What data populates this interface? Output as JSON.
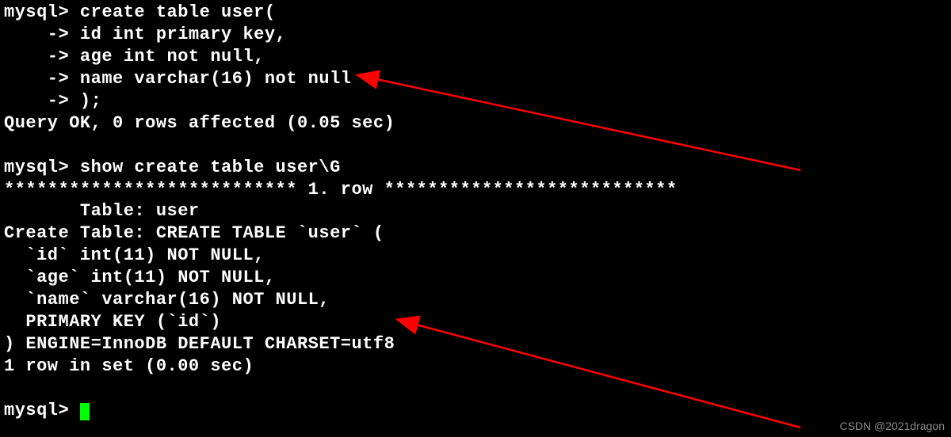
{
  "terminal": {
    "lines": [
      "mysql> create table user(",
      "    -> id int primary key,",
      "    -> age int not null,",
      "    -> name varchar(16) not null",
      "    -> );",
      "Query OK, 0 rows affected (0.05 sec)",
      "",
      "mysql> show create table user\\G",
      "*************************** 1. row ***************************",
      "       Table: user",
      "Create Table: CREATE TABLE `user` (",
      "  `id` int(11) NOT NULL,",
      "  `age` int(11) NOT NULL,",
      "  `name` varchar(16) NOT NULL,",
      "  PRIMARY KEY (`id`)",
      ") ENGINE=InnoDB DEFAULT CHARSET=utf8",
      "1 row in set (0.00 sec)",
      "",
      "mysql> "
    ]
  },
  "watermark": "CSDN @2021dragon"
}
